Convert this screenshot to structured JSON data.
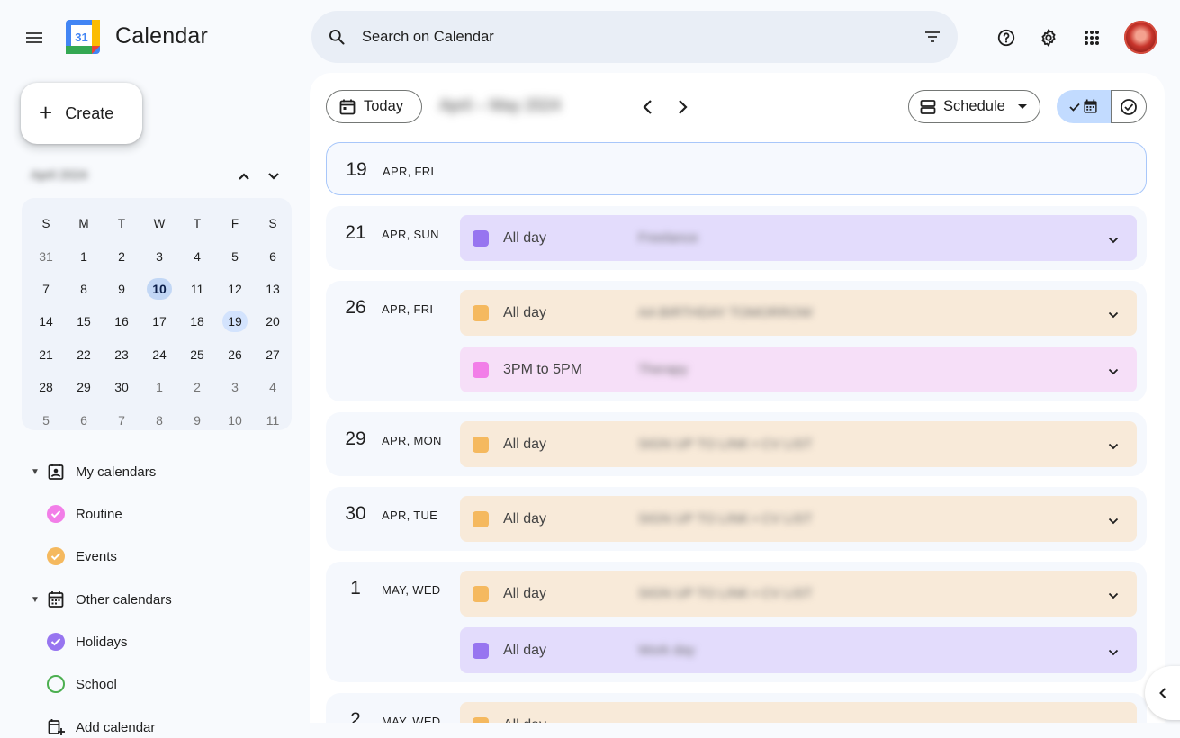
{
  "header": {
    "app_title": "Calendar",
    "logo_day": "31",
    "search_placeholder": "Search on Calendar"
  },
  "sidebar": {
    "create_label": "Create",
    "mini_month_title": "April 2024",
    "weekdays": [
      "S",
      "M",
      "T",
      "W",
      "T",
      "F",
      "S"
    ],
    "weeks": [
      [
        "31",
        "1",
        "2",
        "3",
        "4",
        "5",
        "6"
      ],
      [
        "7",
        "8",
        "9",
        "10",
        "11",
        "12",
        "13"
      ],
      [
        "14",
        "15",
        "16",
        "17",
        "18",
        "19",
        "20"
      ],
      [
        "21",
        "22",
        "23",
        "24",
        "25",
        "26",
        "27"
      ],
      [
        "28",
        "29",
        "30",
        "1",
        "2",
        "3",
        "4"
      ],
      [
        "5",
        "6",
        "7",
        "8",
        "9",
        "10",
        "11"
      ]
    ],
    "today": "10",
    "selected": "19",
    "my_calendars_label": "My calendars",
    "my_calendars": [
      {
        "name": "Routine",
        "color": "#f27ee8",
        "checked": true
      },
      {
        "name": "Events",
        "color": "#f5b95f",
        "checked": true
      }
    ],
    "other_calendars_label": "Other calendars",
    "other_calendars": [
      {
        "name": "Holidays",
        "color": "#9775f0",
        "checked": true
      },
      {
        "name": "School",
        "color": "#4caf50",
        "checked": false
      }
    ],
    "add_calendar_label": "Add calendar"
  },
  "toolbar": {
    "today_label": "Today",
    "date_range": "April – May 2024",
    "view_label": "Schedule"
  },
  "schedule": {
    "days": [
      {
        "num": "19",
        "label": "APR, FRI",
        "events": []
      },
      {
        "num": "21",
        "label": "APR, SUN",
        "events": [
          {
            "time": "All day",
            "title": "Freelance",
            "color": "purple"
          }
        ]
      },
      {
        "num": "26",
        "label": "APR, FRI",
        "events": [
          {
            "time": "All day",
            "title": "AA BIRTHDAY TOMORROW",
            "color": "orange"
          },
          {
            "time": "3PM to 5PM",
            "title": "Therapy",
            "color": "pink"
          }
        ]
      },
      {
        "num": "29",
        "label": "APR, MON",
        "events": [
          {
            "time": "All day",
            "title": "SIGN UP TO LINK  ▪ CV LIST",
            "color": "orange"
          }
        ]
      },
      {
        "num": "30",
        "label": "APR, TUE",
        "events": [
          {
            "time": "All day",
            "title": "SIGN UP TO LINK  ▪ CV LIST",
            "color": "orange"
          }
        ]
      },
      {
        "num": "1",
        "label": "MAY, WED",
        "events": [
          {
            "time": "All day",
            "title": "SIGN UP TO LINK  ▪ CV LIST",
            "color": "orange"
          },
          {
            "time": "All day",
            "title": "Work day",
            "color": "purple"
          }
        ]
      },
      {
        "num": "2",
        "label": "MAY, WED",
        "events": [
          {
            "time": "All day",
            "title": "",
            "color": "orange"
          }
        ]
      }
    ]
  },
  "colors": {
    "purple": "#9775f0",
    "orange": "#f5b95f",
    "pink": "#f27ee8",
    "accent_blue": "#c2dbff"
  }
}
